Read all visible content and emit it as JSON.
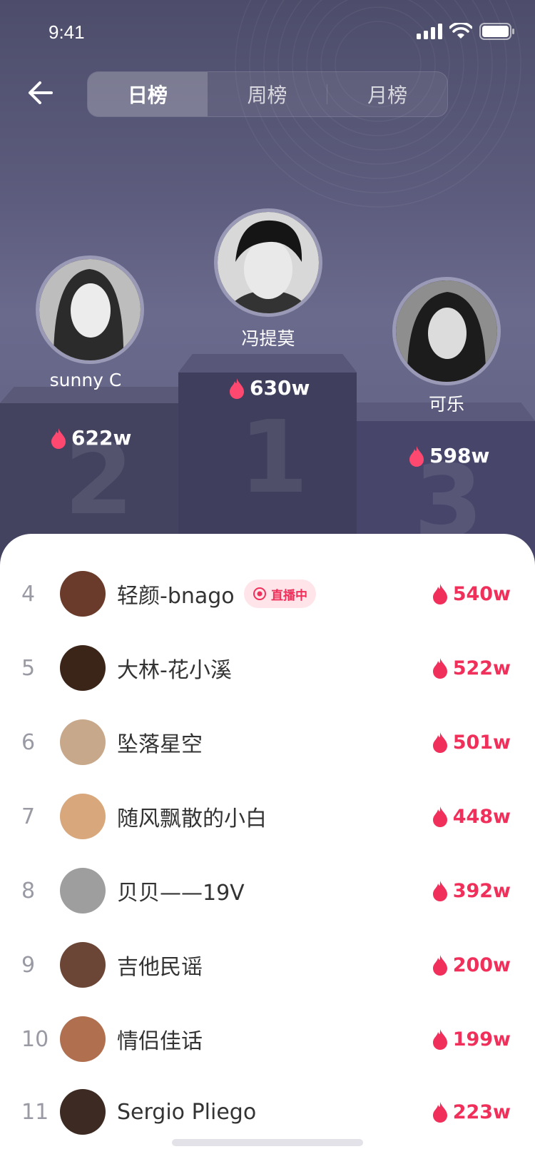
{
  "status_bar": {
    "time": "9:41"
  },
  "tabs": [
    {
      "label": "日榜",
      "active": true
    },
    {
      "label": "周榜",
      "active": false
    },
    {
      "label": "月榜",
      "active": false
    }
  ],
  "podium": {
    "first": {
      "name": "冯提莫",
      "score": "630w",
      "rank": "1"
    },
    "second": {
      "name": "sunny C",
      "score": "622w",
      "rank": "2"
    },
    "third": {
      "name": "可乐",
      "score": "598w",
      "rank": "3"
    }
  },
  "list": [
    {
      "rank": "4",
      "name": "轻颜-bnago",
      "score": "540w",
      "live": "直播中",
      "avatar_color": "#6a3b2a"
    },
    {
      "rank": "5",
      "name": "大林-花小溪",
      "score": "522w",
      "avatar_color": "#3b2418"
    },
    {
      "rank": "6",
      "name": "坠落星空",
      "score": "501w",
      "avatar_color": "#c8a88a"
    },
    {
      "rank": "7",
      "name": "随风飘散的小白",
      "score": "448w",
      "avatar_color": "#d9a77c"
    },
    {
      "rank": "8",
      "name": "贝贝——19V",
      "score": "392w",
      "avatar_color": "#9e9e9e"
    },
    {
      "rank": "9",
      "name": "吉他民谣",
      "score": "200w",
      "avatar_color": "#6b4636"
    },
    {
      "rank": "10",
      "name": "情侣佳话",
      "score": "199w",
      "avatar_color": "#b0704f"
    },
    {
      "rank": "11",
      "name": "Sergio Pliego",
      "score": "223w",
      "avatar_color": "#3d2a22"
    }
  ],
  "colors": {
    "accent": "#f0305a",
    "hero_bg": "#5d5c7e",
    "podium_dark": "#43425f"
  }
}
